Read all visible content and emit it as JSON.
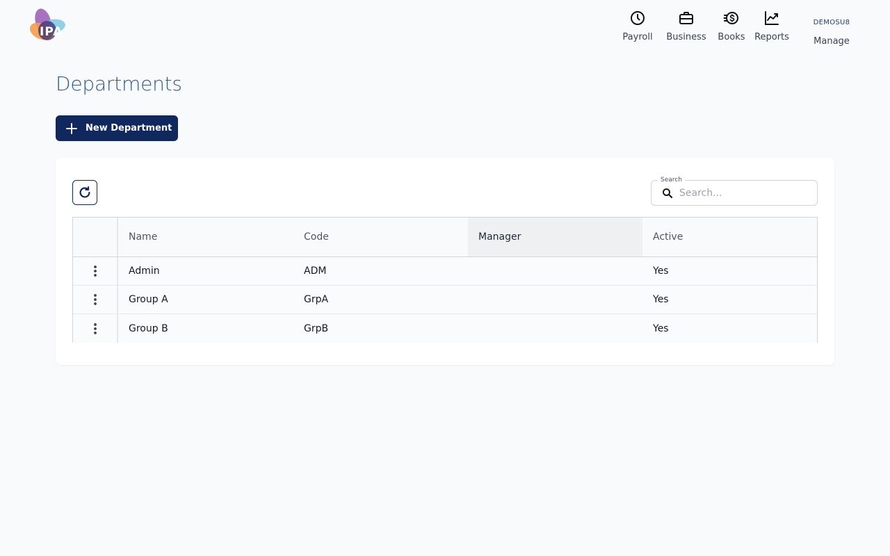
{
  "app": {
    "logo_text": "IPA"
  },
  "nav": {
    "items": [
      {
        "label": "Payroll",
        "icon": "clock-icon"
      },
      {
        "label": "Business",
        "icon": "briefcase-icon"
      },
      {
        "label": "Books",
        "icon": "coin-icon"
      },
      {
        "label": "Reports",
        "icon": "chart-line-icon"
      }
    ],
    "user": {
      "username": "DEMOSU8",
      "label": "Manage"
    }
  },
  "page": {
    "title": "Departments"
  },
  "toolbar": {
    "new_label": "New Department",
    "refresh_icon": "refresh-icon"
  },
  "search": {
    "legend": "Search",
    "placeholder": "Search...",
    "value": ""
  },
  "table": {
    "columns": [
      "Name",
      "Code",
      "Manager",
      "Active"
    ],
    "rows": [
      {
        "name": "Admin",
        "code": "ADM",
        "manager": "",
        "active": "Yes"
      },
      {
        "name": "Group A",
        "code": "GrpA",
        "manager": "",
        "active": "Yes"
      },
      {
        "name": "Group B",
        "code": "GrpB",
        "manager": "",
        "active": "Yes"
      }
    ]
  },
  "colors": {
    "primary": "#10285e",
    "title": "#2e5b86",
    "background": "#f8fafc"
  }
}
